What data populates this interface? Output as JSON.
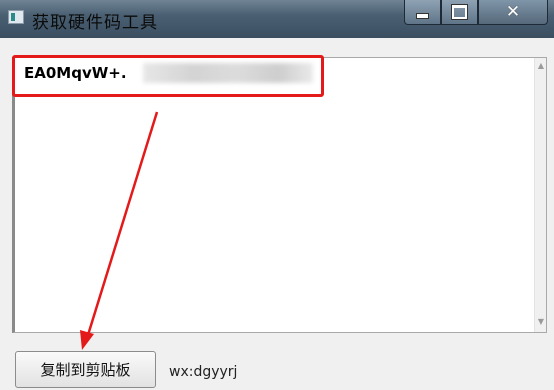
{
  "window": {
    "title": "获取硬件码工具",
    "close_glyph": "✕"
  },
  "editor": {
    "code_visible": "EA0MqvW+."
  },
  "actions": {
    "copy_label": "复制到剪贴板"
  },
  "footer": {
    "contact": "wx:dgyyrj"
  },
  "colors": {
    "highlight": "#e41a1a",
    "titlebar": "#4a6072"
  }
}
